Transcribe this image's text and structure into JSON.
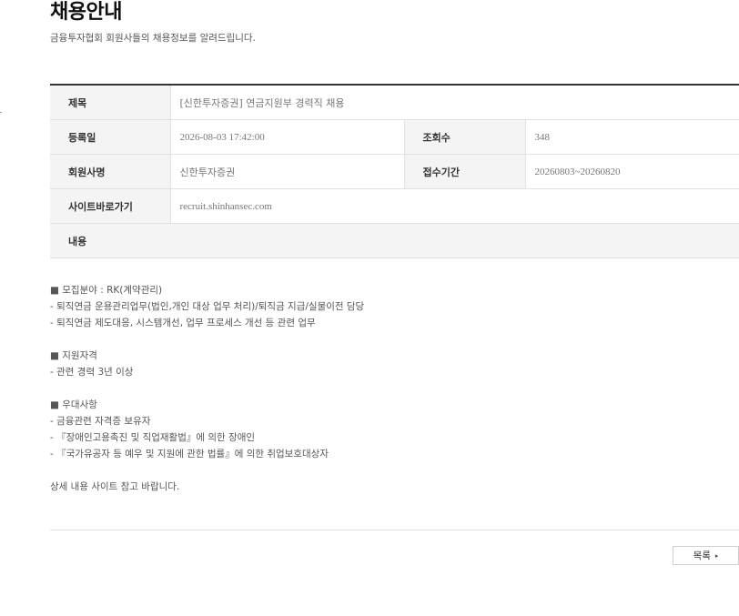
{
  "page": {
    "title": "채용안내",
    "subtitle": "금융투자협회 회원사들의 채용정보를 알려드립니다."
  },
  "info": {
    "title_label": "제목",
    "title_value": "[신한투자증권] 연금지원부 경력직 채용",
    "date_label": "등록일",
    "date_value": "2026-08-03 17:42:00",
    "views_label": "조회수",
    "views_value": "348",
    "company_label": "회원사명",
    "company_value": "신한투자증권",
    "period_label": "접수기간",
    "period_value": "20260803~20260820",
    "site_label": "사이트바로가기",
    "site_value": "recruit.shinhansec.com",
    "content_label": "내용"
  },
  "content": {
    "lines": [
      "■ 모집분야 : RK(계약관리)",
      "- 퇴직연금 운용관리업무(법인,개인 대상 업무 처리)/퇴직금 지급/실물이전 담당",
      "- 퇴직연금 제도대응, 시스템개선, 업무 프로세스 개선 등 관련 업무",
      "■ 지원자격",
      "- 관련 경력 3년 이상",
      "■ 우대사항",
      "- 금융관련 자격증 보유자",
      "- 『장애인고용촉진 및 직업재활법』에 의한 장애인",
      "- 『국가유공자 등 예우 및 지원에 관한 법률』에 의한 취업보호대상자",
      "상세 내용 사이트 참고 바랍니다."
    ]
  },
  "buttons": {
    "list_label": "목록",
    "list_arrow": "▸"
  }
}
